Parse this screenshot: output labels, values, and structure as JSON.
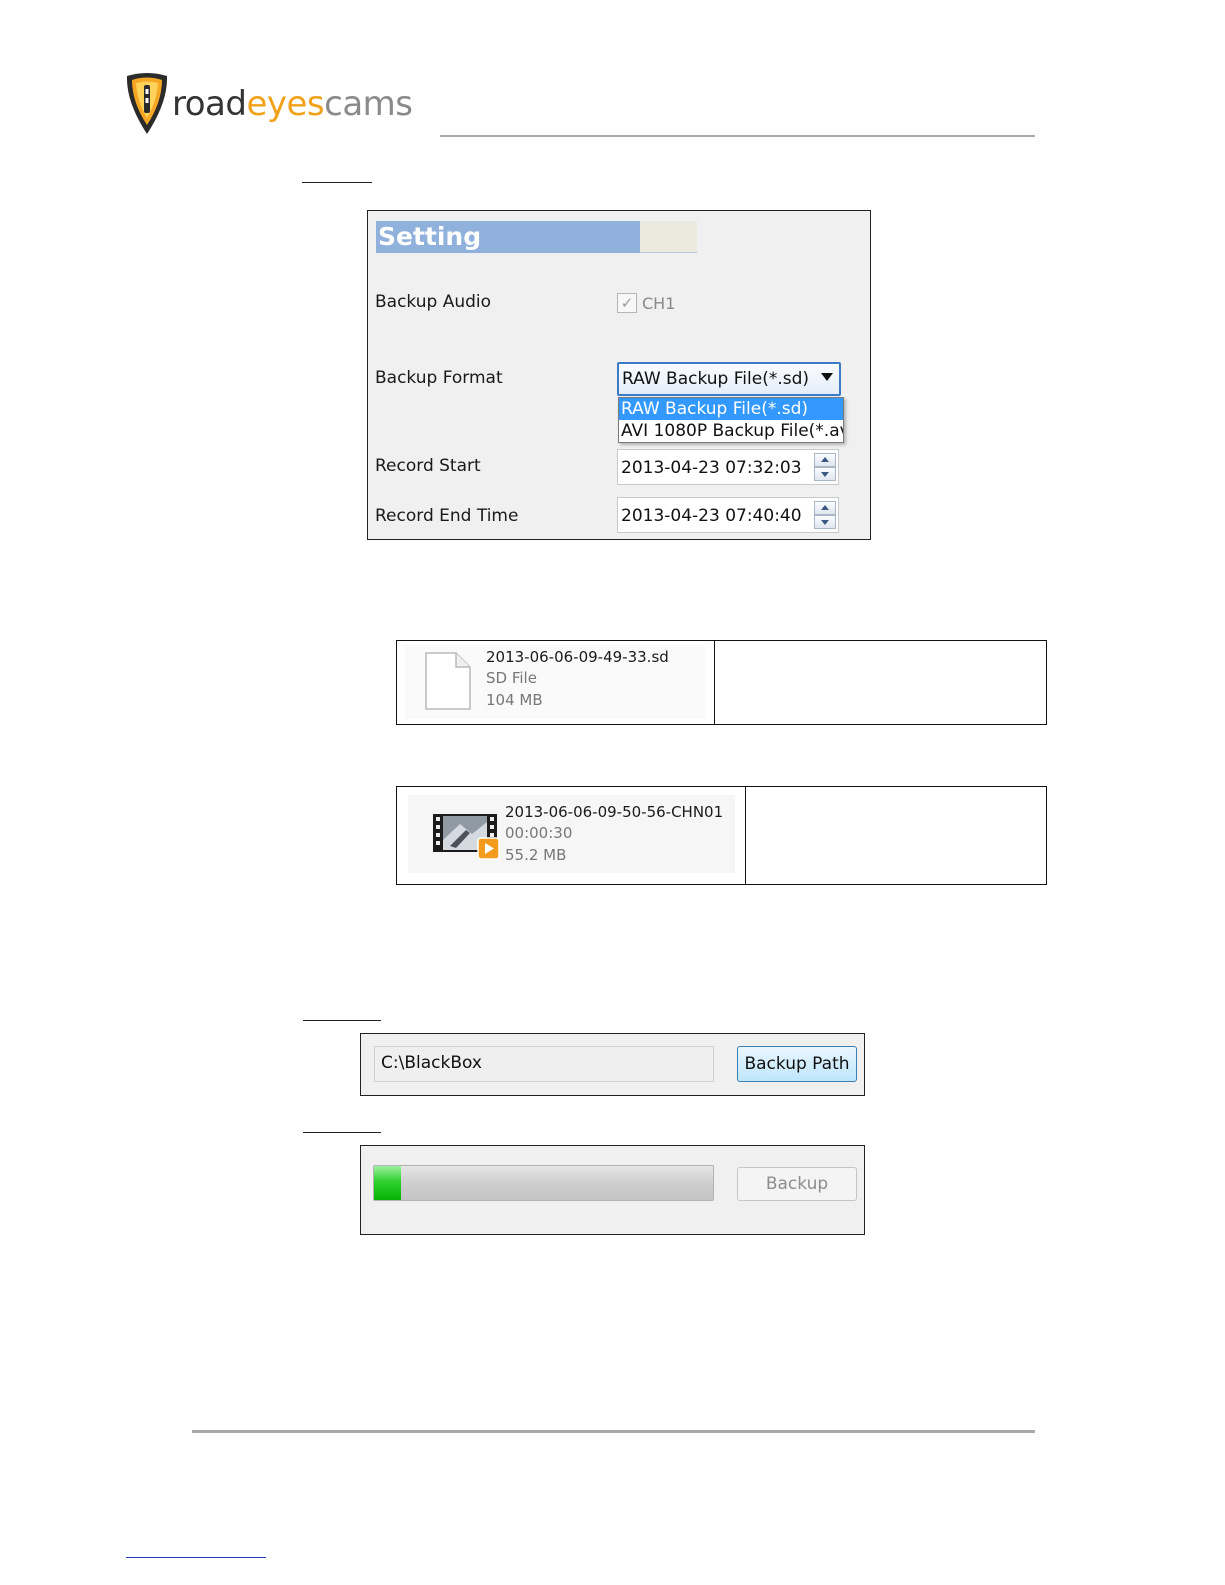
{
  "header": {
    "logo_text_1": "road",
    "logo_text_2": "eyes",
    "logo_text_3": "cams"
  },
  "setting": {
    "title": "Setting",
    "backup_audio_label": "Backup Audio",
    "audio_checkbox_label": "CH1",
    "audio_checked": true,
    "backup_format_label": "Backup Format",
    "backup_format_value": "RAW Backup File(*.sd)",
    "format_options": [
      "RAW Backup File(*.sd)",
      "AVI 1080P Backup File(*.av"
    ],
    "record_start_label": "Record Start",
    "record_start_value": "2013-04-23 07:32:03",
    "record_end_label": "Record End Time",
    "record_end_value": "2013-04-23 07:40:40"
  },
  "files": [
    {
      "name": "2013-06-06-09-49-33.sd",
      "line2": "SD File",
      "line3": "104 MB"
    },
    {
      "name": "2013-06-06-09-50-56-CHN01",
      "line2": "00:00:30",
      "line3": "55.2 MB"
    }
  ],
  "backup_path": {
    "value": "C:\\BlackBox",
    "button_label": "Backup Path"
  },
  "progress": {
    "fraction": 0.08,
    "button_label": "Backup"
  },
  "colors": {
    "progress_green": "#19c019",
    "title_blue": "#8fb1dc",
    "selection_blue": "#3399ff",
    "logo_orange": "#f2a21a"
  }
}
